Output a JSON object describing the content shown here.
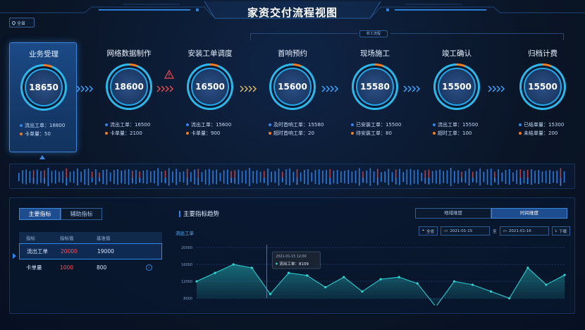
{
  "header": {
    "title": "家资交付流程视图",
    "region_label": "全省",
    "new_process_label": "新工流程"
  },
  "stages": [
    {
      "title": "业务受理",
      "value": "18650",
      "stat1": "流出工单：18800",
      "stat2": "卡单量：50"
    },
    {
      "title": "网络数据制作",
      "value": "18600",
      "stat1": "流出工单：16500",
      "stat2": "卡单量：2100"
    },
    {
      "title": "安装工单调度",
      "value": "16500",
      "stat1": "流出工单：15600",
      "stat2": "卡单量：900"
    },
    {
      "title": "首响预约",
      "value": "15600",
      "stat1": "及时首响工单：15580",
      "stat2": "超时首响工单：20"
    },
    {
      "title": "现场施工",
      "value": "15580",
      "stat1": "已安装工单：15500",
      "stat2": "待安装工单：80"
    },
    {
      "title": "竣工确认",
      "value": "15500",
      "stat1": "流出工单：15500",
      "stat2": "超时工单：100"
    },
    {
      "title": "归档计费",
      "value": "15500",
      "stat1": "已结单量：15300",
      "stat2": "未结单量：200"
    }
  ],
  "tabs": {
    "primary": "主要指标",
    "secondary": "辅助指标"
  },
  "table": {
    "headers": [
      "指标",
      "指标值",
      "基准值"
    ],
    "rows": [
      {
        "name": "流出工单",
        "value": "20000",
        "base": "19000"
      },
      {
        "name": "卡单量",
        "value": "1000",
        "base": "800"
      }
    ]
  },
  "trend": {
    "title": "主要指标趋势",
    "segment_region": "地域维度",
    "segment_time": "时间维度",
    "series_label": "流出工单",
    "filter_region": "全省",
    "date_start": "2021-01-15",
    "date_sep": "至",
    "date_end": "2021-01-16",
    "download": "下载",
    "tooltip_date": "2021-01-15  12:00",
    "tooltip_value": "流出工单：8109"
  },
  "chart_data": {
    "type": "area",
    "yticks": [
      "20000",
      "16000",
      "12000",
      "8000"
    ],
    "ylim": [
      8000,
      20000
    ],
    "series": [
      {
        "values": [
          12000,
          14000,
          16000,
          15200,
          9000,
          14000,
          13400,
          10600,
          13000,
          9600,
          12500,
          13000,
          11500,
          6000,
          12000,
          11200,
          9600,
          8000,
          15200,
          11200,
          13500
        ]
      }
    ],
    "colors": {
      "line": "#2bd9d9",
      "fill": "#1a7f8a"
    }
  },
  "colors": {
    "accent": "#2d86f0",
    "ring_blue": "#2db8ec",
    "ring_orange": "#f07b22",
    "alert": "#ff4d4f"
  }
}
